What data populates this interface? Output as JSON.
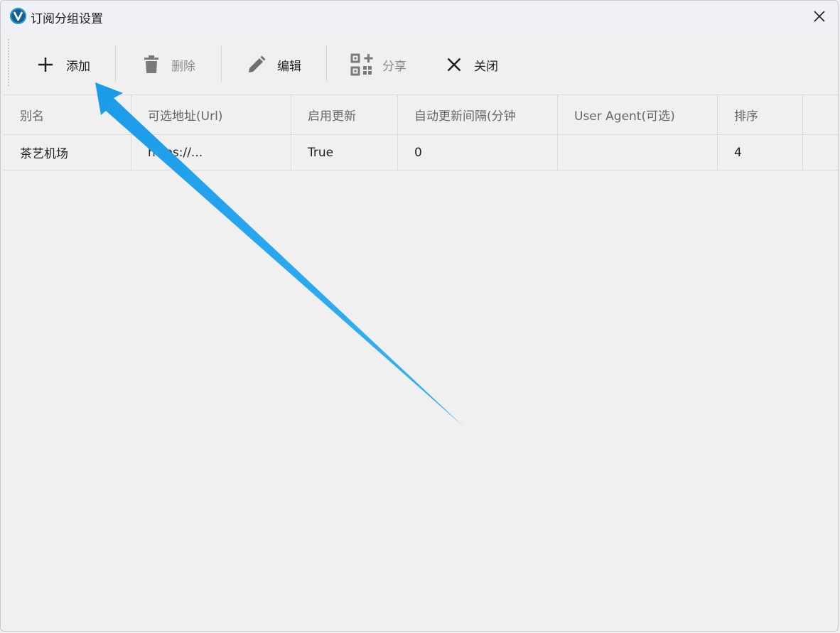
{
  "window": {
    "title": "订阅分组设置",
    "app_icon_letter": "V"
  },
  "toolbar": {
    "add_label": "添加",
    "delete_label": "删除",
    "edit_label": "编辑",
    "share_label": "分享",
    "close_label": "关闭"
  },
  "table": {
    "columns": [
      "别名",
      "可选地址(Url)",
      "启用更新",
      "自动更新间隔(分钟",
      "User Agent(可选)",
      "排序",
      ""
    ],
    "rows": [
      [
        "茶艺机场",
        "https://...",
        "True",
        "0",
        "",
        "4",
        ""
      ]
    ]
  },
  "colors": {
    "annotation_arrow": "#1a9be8",
    "app_icon": "#1a5f8a",
    "disabled_text": "#8a8a8a"
  }
}
